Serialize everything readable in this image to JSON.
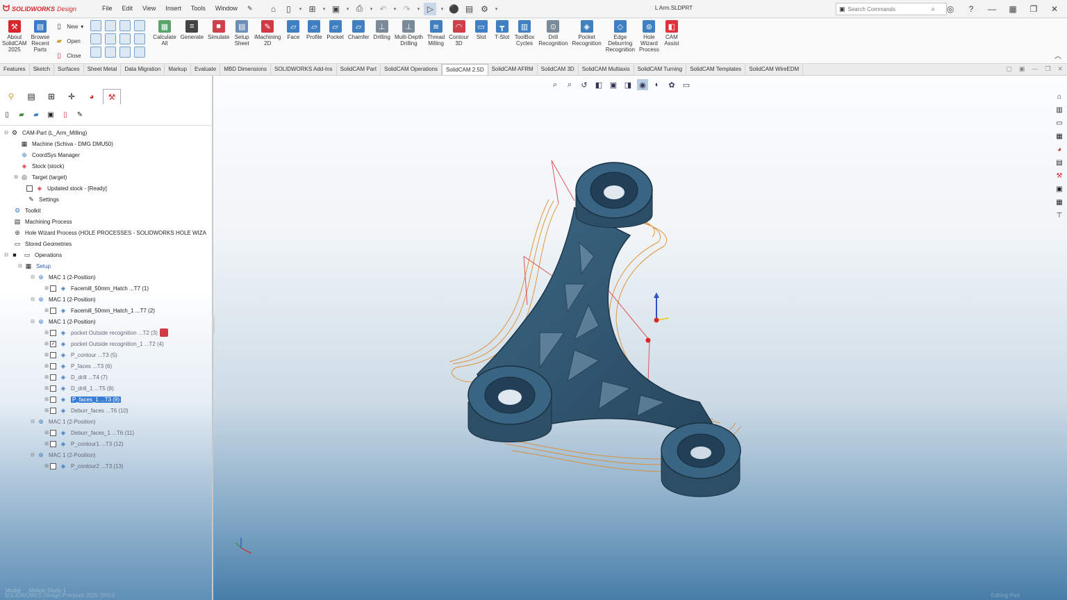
{
  "app": {
    "logo_brand": "SOLIDWORKS",
    "logo_sub": "Design",
    "doc_title": "L Arm.SLDPRT"
  },
  "menu": [
    "File",
    "Edit",
    "View",
    "Insert",
    "Tools",
    "Window"
  ],
  "search": {
    "placeholder": "Search Commands"
  },
  "ribbon": {
    "about": "About\nSolidCAM\n2025",
    "browse": "Browse\nRecent\nParts",
    "new": "New",
    "open": "Open",
    "close": "Close",
    "buttons": [
      "Calculate\nAll",
      "Generate",
      "Simulate",
      "Setup\nSheet",
      "iMachining\n2D",
      "Face",
      "Profile",
      "Pocket",
      "Chamfer",
      "Drilling",
      "Multi-Depth\nDrilling",
      "Thread\nMilling",
      "Contour\n3D",
      "Slot",
      "T-Slot",
      "ToolBox\nCycles",
      "Drill\nRecognition",
      "Pocket\nRecognition",
      "Edge\nDeburring\nRecognition",
      "Hole\nWizard\nProcess",
      "CAM\nAssist"
    ]
  },
  "tabs": [
    "Features",
    "Sketch",
    "Surfaces",
    "Sheet Metal",
    "Data Migration",
    "Markup",
    "Evaluate",
    "MBD Dimensions",
    "SOLIDWORKS Add-Ins",
    "SolidCAM Part",
    "SolidCAM Operations",
    "SolidCAM 2.5D",
    "SolidCAM AFRM",
    "SolidCAM 3D",
    "SolidCAM Multiaxis",
    "SolidCAM Turning",
    "SolidCAM Templates",
    "SolidCAM WireEDM"
  ],
  "active_tab": "SolidCAM 2.5D",
  "tree": {
    "cam_part": "CAM-Part (L_Arm_Milling)",
    "machine": "Machine (Schiva - DMG DMU50)",
    "coordsys": "CoordSys Manager",
    "stock": "Stock (stock)",
    "target": "Target (target)",
    "updated_stock": "Updated stock - [Ready]",
    "settings": "Settings",
    "toolkit": "Toolkit",
    "machining_process": "Machining Process",
    "hole_wizard": "Hole Wizard Process (HOLE PROCESSES - SOLIDWORKS HOLE WIZA",
    "stored_geometries": "Stored Geometries",
    "operations": "Operations",
    "setup": "Setup",
    "mac1": "MAC 1 (2-Position)",
    "mac2": "MAC 1 (2-Position)",
    "mac3": "MAC 1 (2-Position)",
    "mac4": "MAC 1 (2-Position)",
    "mac5": "MAC 1 (2-Position)",
    "op1": "Facemill_50mm_Hatch ...T7 (1)",
    "op2": "Facemill_50mm_Hatch_1 ...T7 (2)",
    "op3": "pocket Outside recognition ...T2 (3)",
    "op4": "pocket Outside recognition_1 ...T2 (4)",
    "op5": "P_contour ...T3 (5)",
    "op6": "P_faces ...T3 (6)",
    "op7": "D_drill ...T4 (7)",
    "op8": "D_drill_1 ...T5 (8)",
    "op9": "P_faces_1 ...T3 (9)",
    "op10": "Deburr_faces ...T6 (10)",
    "op11": "Deburr_faces_1 ...T6 (11)",
    "op12": "P_contour1 ...T3 (12)",
    "op13": "P_contour2 ...T3 (13)"
  },
  "status": {
    "model_tab": "Model",
    "motion_tab": "Motion Study 1",
    "line": "SOLIDWORKS Design Premium 2025 SP0.0",
    "right": "Editing Part"
  }
}
